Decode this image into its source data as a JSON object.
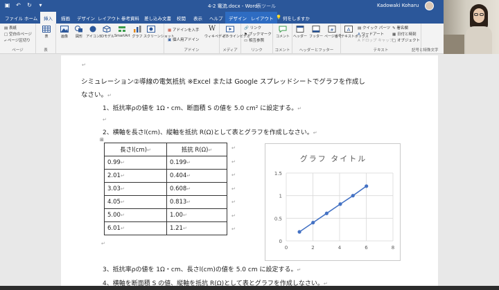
{
  "window": {
    "doc_title": "4-2 電流.docx  -  Word",
    "context_title": "表ツール",
    "user_name": "Kadowaki Koharu"
  },
  "tabs": [
    {
      "label": "ファイル",
      "active": false
    },
    {
      "label": "ホーム",
      "active": false
    },
    {
      "label": "挿入",
      "active": true
    },
    {
      "label": "描画",
      "active": false
    },
    {
      "label": "デザイン",
      "active": false
    },
    {
      "label": "レイアウト",
      "active": false
    },
    {
      "label": "参考資料",
      "active": false
    },
    {
      "label": "差し込み文書",
      "active": false
    },
    {
      "label": "校閲",
      "active": false
    },
    {
      "label": "表示",
      "active": false
    },
    {
      "label": "ヘルプ",
      "active": false
    },
    {
      "label": "デザイン",
      "active": false,
      "context": true
    },
    {
      "label": "レイアウト",
      "active": false,
      "context": true
    },
    {
      "label": "何をしますか",
      "active": false
    }
  ],
  "ribbon": {
    "pages_items": [
      "表紙",
      "空白のページ",
      "ページ区切り"
    ],
    "pages_label": "ページ",
    "table_label": "表",
    "table_btn": "表",
    "illus": [
      "画像",
      "図形",
      "アイコン",
      "3Dモデル",
      "SmartArt",
      "グラフ",
      "スクリーンショット"
    ],
    "addin_items": [
      "アドインを入手",
      "個人用アドイン"
    ],
    "wiki": "ウィキペディア",
    "addin_label": "アドイン",
    "media_btn": "オンラインビデオ",
    "media_label": "メディア",
    "link_items": [
      "リンク",
      "ブックマーク",
      "相互参照"
    ],
    "link_label": "リンク",
    "comment_btn": "コメント",
    "comment_label": "コメント",
    "hf_items": [
      "ヘッダー",
      "フッター",
      "ページ番号"
    ],
    "hf_label": "ヘッダーとフッター",
    "text_items": [
      "テキストボックス",
      "クイック パーツ",
      "ワードアート",
      "ドロップ キャップ",
      "署名欄",
      "日付と時刻",
      "オブジェクト"
    ],
    "text_label": "テキスト",
    "symbol_label": "記号と特殊文字"
  },
  "document": {
    "heading": "シミュレーション②導線の電気抵抗 ※Excel または Google スプレッドシートでグラフを作成し",
    "heading_cont": "なさい。",
    "step1": "1、抵抗率ρの値を 1Ω・cm、断面積 S の値を 5.0 cm² に設定する。",
    "step2": "2、横軸を長さl(cm)、縦軸を抵抗 R(Ω)として表とグラフを作成しなさい。",
    "step3": "3、抵抗率ρの値を 1Ω・cm、長さl(cm)の値を 5.0 cm に設定する。",
    "step4": "4、横軸を断面積 S の値、縦軸を抵抗 R(Ω)として表とグラフを作成しなさい。",
    "return_mark": "↵"
  },
  "table": {
    "headers": [
      "長さl(cm)",
      "抵抗 R(Ω)"
    ],
    "rows": [
      [
        "0.99",
        "0.199"
      ],
      [
        "2.01",
        "0.404"
      ],
      [
        "3.03",
        "0.608"
      ],
      [
        "4.05",
        "0.813"
      ],
      [
        "5.00",
        "1.00"
      ],
      [
        "6.01",
        "1.21"
      ]
    ]
  },
  "chart_data": {
    "type": "scatter",
    "title": "グラフ タイトル",
    "x": [
      0.99,
      2.01,
      3.03,
      4.05,
      5.0,
      6.01
    ],
    "y": [
      0.199,
      0.404,
      0.608,
      0.813,
      1.0,
      1.21
    ],
    "xlim": [
      0,
      8
    ],
    "ylim": [
      0,
      1.5
    ],
    "xticks": [
      "0",
      "2",
      "4",
      "6",
      "8"
    ],
    "yticks": [
      "0",
      "0.5",
      "1",
      "1.5"
    ],
    "grid": true,
    "legend": "none",
    "series_color": "#4472c4"
  },
  "colors": {
    "word_blue": "#2b579a",
    "ribbon_bg": "#f3f3f3"
  }
}
